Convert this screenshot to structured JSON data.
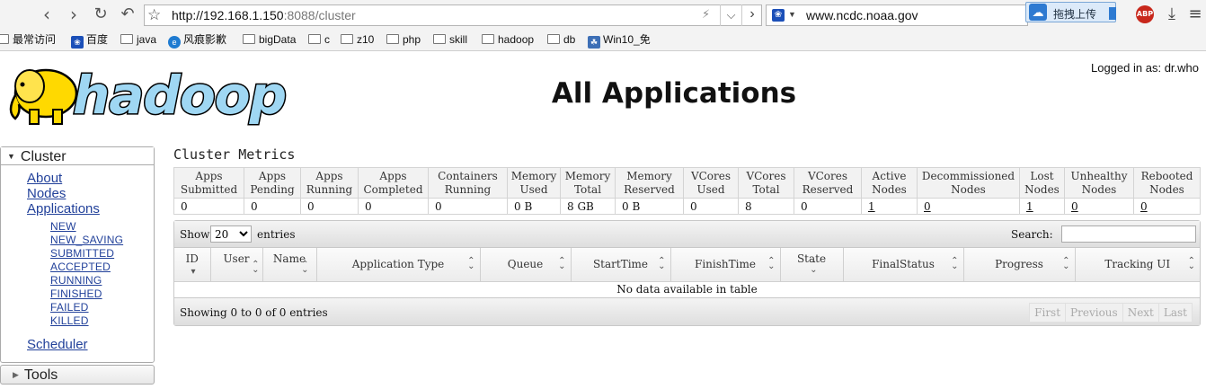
{
  "browser": {
    "url_main": "http://192.168.1.150",
    "url_rest": ":8088/cluster",
    "search_value": "www.ncdc.noaa.gov",
    "cloud_label": "拖拽上传",
    "abp_label": "ABP",
    "bookmarks": [
      "最常访问",
      "百度",
      "java",
      "风痕影歉",
      "bigData",
      "c",
      "z10",
      "php",
      "skill",
      "hadoop",
      "db",
      "Win10_免"
    ]
  },
  "header": {
    "logo_text": "hadoop",
    "title": "All Applications",
    "logged_in": "Logged in as: dr.who"
  },
  "nav": {
    "cluster_label": "Cluster",
    "items": [
      "About",
      "Nodes",
      "Applications"
    ],
    "app_states": [
      "NEW",
      "NEW_SAVING",
      "SUBMITTED",
      "ACCEPTED",
      "RUNNING",
      "FINISHED",
      "FAILED",
      "KILLED"
    ],
    "scheduler": "Scheduler",
    "tools_label": "Tools"
  },
  "metrics": {
    "title": "Cluster Metrics",
    "headers": [
      [
        "Apps",
        "Submitted"
      ],
      [
        "Apps",
        "Pending"
      ],
      [
        "Apps",
        "Running"
      ],
      [
        "Apps",
        "Completed"
      ],
      [
        "Containers",
        "Running"
      ],
      [
        "Memory",
        "Used"
      ],
      [
        "Memory",
        "Total"
      ],
      [
        "Memory",
        "Reserved"
      ],
      [
        "VCores",
        "Used"
      ],
      [
        "VCores",
        "Total"
      ],
      [
        "VCores",
        "Reserved"
      ],
      [
        "Active",
        "Nodes"
      ],
      [
        "Decommissioned",
        "Nodes"
      ],
      [
        "Lost",
        "Nodes"
      ],
      [
        "Unhealthy",
        "Nodes"
      ],
      [
        "Rebooted",
        "Nodes"
      ]
    ],
    "values": [
      "0",
      "0",
      "0",
      "0",
      "0",
      "0 B",
      "8 GB",
      "0 B",
      "0",
      "8",
      "0",
      "1",
      "0",
      "1",
      "0",
      "0"
    ]
  },
  "apps_table": {
    "show_label": "Show",
    "page_size": "20",
    "entries_label": "entries",
    "search_label": "Search:",
    "columns": [
      "ID",
      "User",
      "Name",
      "Application Type",
      "Queue",
      "StartTime",
      "FinishTime",
      "State",
      "FinalStatus",
      "Progress",
      "Tracking UI"
    ],
    "empty_message": "No data available in table",
    "info": "Showing 0 to 0 of 0 entries",
    "pager": [
      "First",
      "Previous",
      "Next",
      "Last"
    ]
  }
}
